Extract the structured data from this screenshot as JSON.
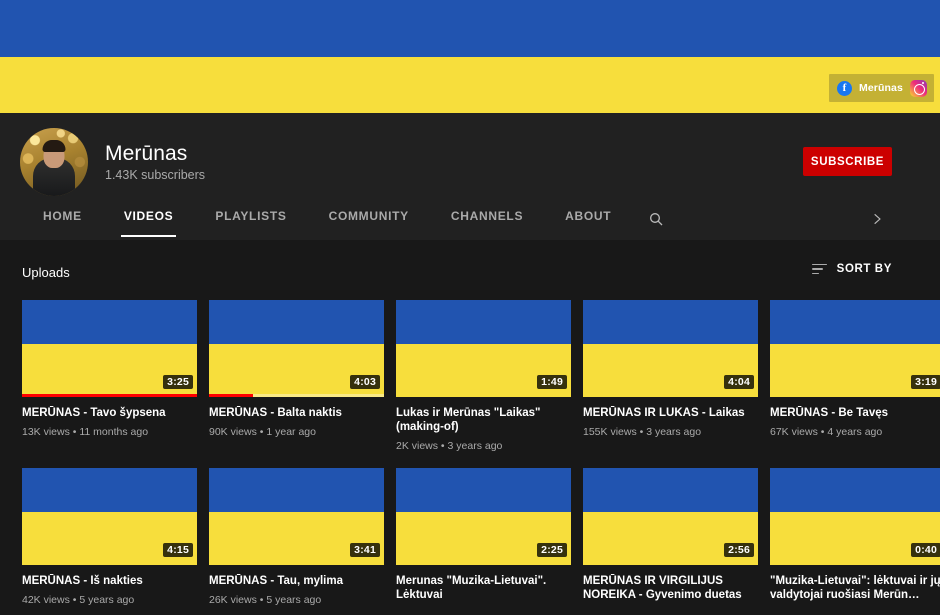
{
  "banner": {
    "colors": {
      "top": "#2154b0",
      "bottom": "#f7de3c"
    },
    "social": {
      "facebook_icon": "facebook-icon",
      "label": "Merūnas",
      "instagram_icon": "instagram-icon"
    }
  },
  "channel": {
    "name": "Merūnas",
    "subscribers": "1.43K subscribers",
    "subscribe_label": "SUBSCRIBE",
    "subscribe_color": "#cc0000",
    "avatar_alt": "channel-avatar"
  },
  "tabs": [
    {
      "label": "HOME",
      "active": false
    },
    {
      "label": "VIDEOS",
      "active": true
    },
    {
      "label": "PLAYLISTS",
      "active": false
    },
    {
      "label": "COMMUNITY",
      "active": false
    },
    {
      "label": "CHANNELS",
      "active": false
    },
    {
      "label": "ABOUT",
      "active": false
    }
  ],
  "tab_icons": {
    "search": "search-icon",
    "expand": "chevron-right-icon"
  },
  "section": {
    "title": "Uploads",
    "sort_label": "SORT BY",
    "sort_icon": "sort-icon"
  },
  "videos": [
    {
      "title": "MERŪNAS - Tavo šypsena",
      "meta": "13K views • 11 months ago",
      "duration": "3:25",
      "progress": 100
    },
    {
      "title": "MERŪNAS - Balta naktis",
      "meta": "90K views • 1 year ago",
      "duration": "4:03",
      "progress": 25
    },
    {
      "title": "Lukas ir Merūnas \"Laikas\" (making-of)",
      "meta": "2K views • 3 years ago",
      "duration": "1:49",
      "progress": 0
    },
    {
      "title": "MERŪNAS IR LUKAS - Laikas",
      "meta": "155K views • 3 years ago",
      "duration": "4:04",
      "progress": 0
    },
    {
      "title": "MERŪNAS - Be Tavęs",
      "meta": "67K views • 4 years ago",
      "duration": "3:19",
      "progress": 0
    },
    {
      "title": "MERŪNAS - Iš nakties",
      "meta": "42K views • 5 years ago",
      "duration": "4:15",
      "progress": 0
    },
    {
      "title": "MERŪNAS - Tau, mylima",
      "meta": "26K views • 5 years ago",
      "duration": "3:41",
      "progress": 0
    },
    {
      "title": "Merunas \"Muzika-Lietuvai\". Lėktuvai",
      "meta": "",
      "duration": "2:25",
      "progress": 0
    },
    {
      "title": "MERŪNAS IR VIRGILIJUS NOREIKA - Gyvenimo duetas",
      "meta": "",
      "duration": "2:56",
      "progress": 0
    },
    {
      "title": "\"Muzika-Lietuvai\": lėktuvai ir jų valdytojai ruošiasi Merūn…",
      "meta": "",
      "duration": "0:40",
      "progress": 0
    }
  ]
}
